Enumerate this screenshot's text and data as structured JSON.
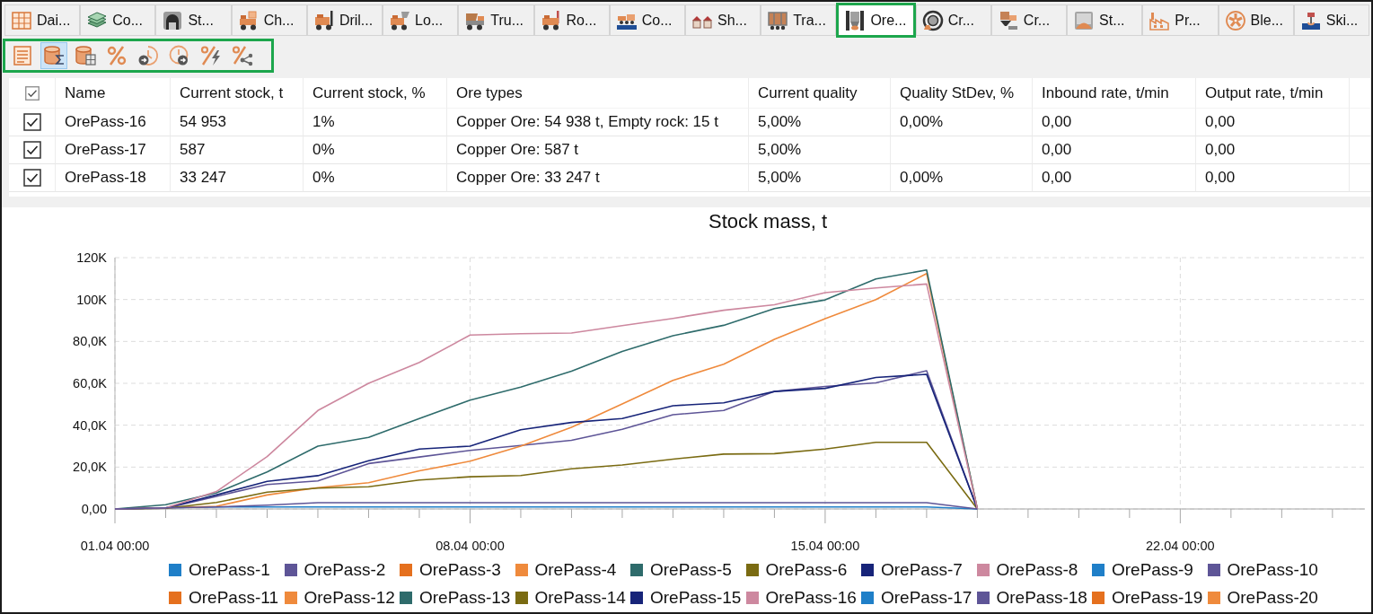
{
  "tabs": [
    {
      "label": "Dai...",
      "selected": false,
      "highlighted": false
    },
    {
      "label": "Co...",
      "selected": false,
      "highlighted": false
    },
    {
      "label": "St...",
      "selected": false,
      "highlighted": false
    },
    {
      "label": "Ch...",
      "selected": false,
      "highlighted": false
    },
    {
      "label": "Dril...",
      "selected": false,
      "highlighted": false
    },
    {
      "label": "Lo...",
      "selected": false,
      "highlighted": false
    },
    {
      "label": "Tru...",
      "selected": false,
      "highlighted": false
    },
    {
      "label": "Ro...",
      "selected": false,
      "highlighted": false
    },
    {
      "label": "Co...",
      "selected": false,
      "highlighted": false
    },
    {
      "label": "Sh...",
      "selected": false,
      "highlighted": false
    },
    {
      "label": "Tra...",
      "selected": false,
      "highlighted": false
    },
    {
      "label": "Ore...",
      "selected": true,
      "highlighted": true
    },
    {
      "label": "Cr...",
      "selected": false,
      "highlighted": false
    },
    {
      "label": "Cr...",
      "selected": false,
      "highlighted": false
    },
    {
      "label": "St...",
      "selected": false,
      "highlighted": false
    },
    {
      "label": "Pr...",
      "selected": false,
      "highlighted": false
    },
    {
      "label": "Ble...",
      "selected": false,
      "highlighted": false
    },
    {
      "label": "Ski...",
      "selected": false,
      "highlighted": false
    }
  ],
  "toolbar": {
    "highlighted": true,
    "buttons": [
      {
        "selected": false
      },
      {
        "selected": true
      },
      {
        "selected": false
      },
      {
        "selected": false
      },
      {
        "selected": false
      },
      {
        "selected": false
      },
      {
        "selected": false
      },
      {
        "selected": false
      }
    ]
  },
  "table": {
    "header_checked": true,
    "columns": [
      "Name",
      "Current stock, t",
      "Current stock, %",
      "Ore types",
      "Current quality",
      "Quality StDev, %",
      "Inbound rate, t/min",
      "Output rate, t/min"
    ],
    "rows": [
      {
        "checked": true,
        "cells": [
          "OrePass-16",
          "54 953",
          "1%",
          "Copper Ore: 54 938 t, Empty rock: 15 t",
          "5,00%",
          "0,00%",
          "0,00",
          "0,00"
        ]
      },
      {
        "checked": true,
        "cells": [
          "OrePass-17",
          "587",
          "0%",
          "Copper Ore: 587 t",
          "5,00%",
          null,
          "0,00",
          "0,00"
        ]
      },
      {
        "checked": true,
        "cells": [
          "OrePass-18",
          "33 247",
          "0%",
          "Copper Ore: 33 247 t",
          "5,00%",
          "0,00%",
          "0,00",
          "0,00"
        ]
      }
    ]
  },
  "chart": {
    "chart_data": {
      "type": "line",
      "title": "Stock mass, t",
      "grid": true,
      "legend": "bottom",
      "categories": [
        "01.04 00:00",
        null,
        null,
        null,
        null,
        null,
        null,
        "08.04 00:00",
        null,
        null,
        null,
        null,
        null,
        null,
        "15.04 00:00",
        null,
        null,
        null,
        null,
        null,
        null,
        "22.04 00:00",
        null,
        null,
        null
      ],
      "ylim": [
        0,
        120000
      ],
      "yticks": [
        {
          "value": 0,
          "label": "0,00"
        },
        {
          "value": 20000,
          "label": "20,0K"
        },
        {
          "value": 40000,
          "label": "40,0K"
        },
        {
          "value": 60000,
          "label": "60,0K"
        },
        {
          "value": 80000,
          "label": "80,0K"
        },
        {
          "value": 100000,
          "label": "100K"
        },
        {
          "value": 120000,
          "label": "120K"
        }
      ],
      "series": [
        {
          "name": "OrePass-1",
          "color": "#1f7fc8",
          "values": [
            0,
            500,
            1000,
            1000,
            1000,
            1000,
            1000,
            1000,
            1000,
            1000,
            1000,
            1000,
            1000,
            1000,
            1000,
            1000,
            1000,
            0,
            null,
            null,
            null,
            null,
            null,
            null,
            null
          ]
        },
        {
          "name": "OrePass-2",
          "color": "#5e5597",
          "values": [
            0,
            300,
            6000,
            11700,
            13400,
            21700,
            24800,
            28000,
            30300,
            32800,
            38000,
            45000,
            47000,
            56100,
            58500,
            60200,
            66000,
            0,
            null,
            null,
            null,
            null,
            null,
            null,
            null
          ]
        },
        {
          "name": "OrePass-3",
          "color": "#e5701e",
          "values": [
            null,
            null,
            null,
            null,
            null,
            null,
            null,
            null,
            null,
            null,
            null,
            null,
            null,
            null,
            null,
            null,
            null,
            null,
            null,
            null,
            null,
            null,
            null,
            null,
            null
          ]
        },
        {
          "name": "OrePass-4",
          "color": "#ef8a3c",
          "values": [
            0,
            500,
            1300,
            6700,
            10200,
            12500,
            18200,
            22800,
            30000,
            39000,
            50100,
            61400,
            69100,
            81000,
            90800,
            100000,
            112400,
            0,
            null,
            null,
            null,
            null,
            null,
            null,
            null
          ]
        },
        {
          "name": "OrePass-5",
          "color": "#2e6b6b",
          "values": [
            0,
            2000,
            7700,
            17700,
            30000,
            34200,
            43200,
            52000,
            58200,
            65800,
            75200,
            82700,
            87700,
            95700,
            99800,
            109800,
            114100,
            0,
            null,
            null,
            null,
            null,
            null,
            null,
            null
          ]
        },
        {
          "name": "OrePass-6",
          "color": "#7a6b12",
          "values": [
            0,
            300,
            3100,
            8000,
            10000,
            10600,
            13800,
            15400,
            16000,
            19200,
            21000,
            23800,
            26200,
            26400,
            28600,
            31800,
            31800,
            0,
            null,
            null,
            null,
            null,
            null,
            null,
            null
          ]
        },
        {
          "name": "OrePass-7",
          "color": "#172479",
          "values": [
            0,
            500,
            6700,
            13200,
            15900,
            23000,
            28600,
            30000,
            37800,
            41300,
            43200,
            49300,
            50700,
            56100,
            57600,
            62800,
            64300,
            0,
            null,
            null,
            null,
            null,
            null,
            null,
            null
          ]
        },
        {
          "name": "OrePass-8",
          "color": "#cd889f",
          "values": [
            0,
            500,
            8300,
            25000,
            47000,
            60000,
            70000,
            83000,
            83700,
            84000,
            87500,
            91000,
            94900,
            97500,
            103300,
            105500,
            107400,
            0,
            null,
            null,
            null,
            null,
            null,
            null,
            null
          ]
        },
        {
          "name": "OrePass-9",
          "color": "#1f7fc8",
          "values": [
            null,
            null,
            null,
            null,
            null,
            null,
            null,
            null,
            null,
            null,
            null,
            null,
            null,
            null,
            null,
            null,
            null,
            null,
            null,
            null,
            null,
            null,
            null,
            null,
            null
          ]
        },
        {
          "name": "OrePass-10",
          "color": "#5e5597",
          "values": [
            0,
            500,
            1000,
            1800,
            3000,
            3000,
            3000,
            3000,
            3000,
            3000,
            3000,
            3000,
            3000,
            3000,
            3000,
            3000,
            3000,
            0,
            null,
            null,
            null,
            null,
            null,
            null,
            null
          ]
        },
        {
          "name": "OrePass-11",
          "color": "#e5701e",
          "values": [
            null,
            null,
            null,
            null,
            null,
            null,
            null,
            null,
            null,
            null,
            null,
            null,
            null,
            null,
            null,
            null,
            null,
            null,
            null,
            null,
            null,
            null,
            null,
            null,
            null
          ]
        },
        {
          "name": "OrePass-12",
          "color": "#ef8a3c",
          "values": [
            null,
            null,
            null,
            null,
            null,
            null,
            null,
            null,
            null,
            null,
            null,
            null,
            null,
            null,
            null,
            null,
            null,
            null,
            null,
            null,
            null,
            null,
            null,
            null,
            null
          ]
        },
        {
          "name": "OrePass-13",
          "color": "#2e6b6b",
          "values": [
            null,
            null,
            null,
            null,
            null,
            null,
            null,
            null,
            null,
            null,
            null,
            null,
            null,
            null,
            null,
            null,
            null,
            null,
            null,
            null,
            null,
            null,
            null,
            null,
            null
          ]
        },
        {
          "name": "OrePass-14",
          "color": "#7a6b12",
          "values": [
            null,
            null,
            null,
            null,
            null,
            null,
            null,
            null,
            null,
            null,
            null,
            null,
            null,
            null,
            null,
            null,
            null,
            null,
            null,
            null,
            null,
            null,
            null,
            null,
            null
          ]
        },
        {
          "name": "OrePass-15",
          "color": "#172479",
          "values": [
            null,
            null,
            null,
            null,
            null,
            null,
            null,
            null,
            null,
            null,
            null,
            null,
            null,
            null,
            null,
            null,
            null,
            null,
            null,
            null,
            null,
            null,
            null,
            null,
            null
          ]
        },
        {
          "name": "OrePass-16",
          "color": "#cd889f",
          "values": [
            null,
            null,
            null,
            null,
            null,
            null,
            null,
            null,
            null,
            null,
            null,
            null,
            null,
            null,
            null,
            null,
            null,
            null,
            null,
            null,
            null,
            null,
            null,
            null,
            null
          ]
        },
        {
          "name": "OrePass-17",
          "color": "#1f7fc8",
          "values": [
            null,
            null,
            null,
            null,
            null,
            null,
            null,
            null,
            null,
            null,
            null,
            null,
            null,
            null,
            null,
            null,
            null,
            null,
            null,
            null,
            null,
            null,
            null,
            null,
            null
          ]
        },
        {
          "name": "OrePass-18",
          "color": "#5e5597",
          "values": [
            null,
            null,
            null,
            null,
            null,
            null,
            null,
            null,
            null,
            null,
            null,
            null,
            null,
            null,
            null,
            null,
            null,
            null,
            null,
            null,
            null,
            null,
            null,
            null,
            null
          ]
        },
        {
          "name": "OrePass-19",
          "color": "#e5701e",
          "values": [
            null,
            null,
            null,
            null,
            null,
            null,
            null,
            null,
            null,
            null,
            null,
            null,
            null,
            null,
            null,
            null,
            null,
            null,
            null,
            null,
            null,
            null,
            null,
            null,
            null
          ]
        },
        {
          "name": "OrePass-20",
          "color": "#ef8a3c",
          "values": [
            null,
            null,
            null,
            null,
            null,
            null,
            null,
            null,
            null,
            null,
            null,
            null,
            null,
            null,
            null,
            null,
            null,
            null,
            null,
            null,
            null,
            null,
            null,
            null,
            null
          ]
        }
      ]
    }
  }
}
